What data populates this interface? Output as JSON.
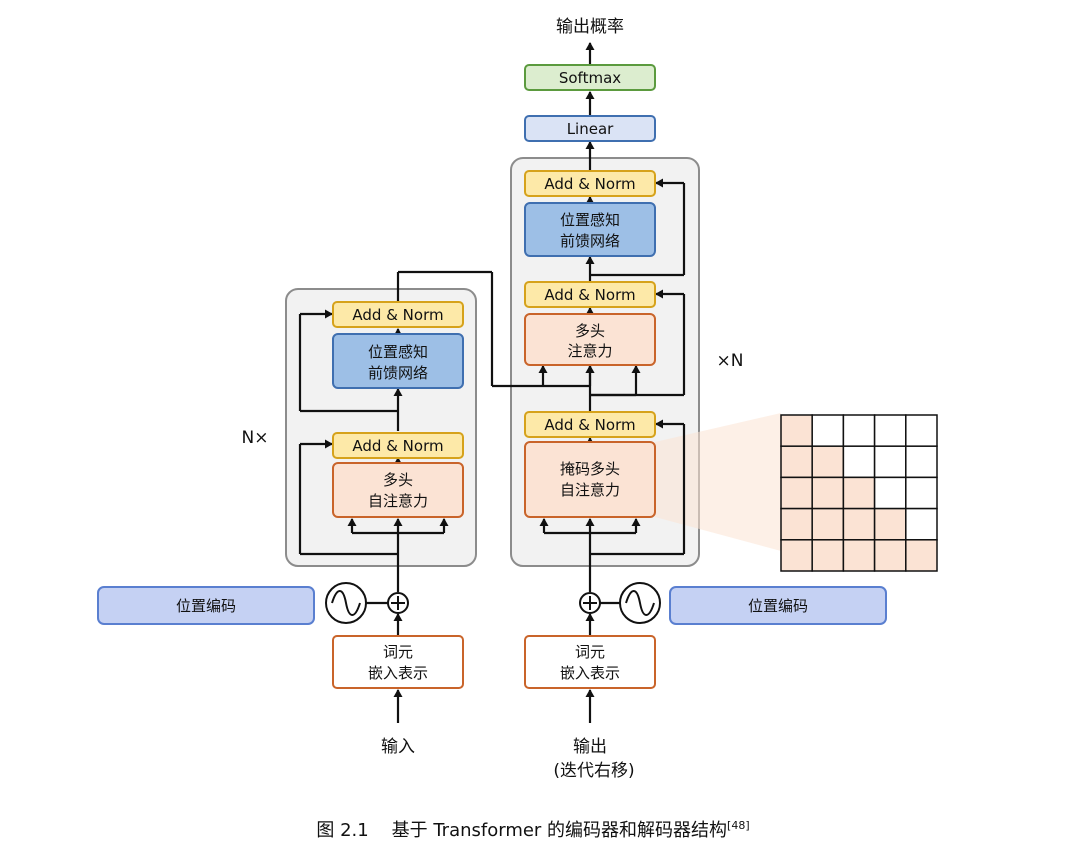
{
  "encoder": {
    "repeat_label": "N×",
    "input_label": "输入",
    "embedding_label": [
      "词元",
      "嵌入表示"
    ],
    "positional_encoding_label": "位置编码",
    "self_attention_label": [
      "多头",
      "自注意力"
    ],
    "ffn_label": [
      "位置感知",
      "前馈网络"
    ],
    "add_norm_label": "Add & Norm"
  },
  "decoder": {
    "repeat_label": "×N",
    "input_label": [
      "输出",
      "(迭代右移)"
    ],
    "embedding_label": [
      "词元",
      "嵌入表示"
    ],
    "positional_encoding_label": "位置编码",
    "masked_attention_label": [
      "掩码多头",
      "自注意力"
    ],
    "cross_attention_label": [
      "多头",
      "注意力"
    ],
    "ffn_label": [
      "位置感知",
      "前馈网络"
    ],
    "add_norm_label": "Add & Norm",
    "linear_label": "Linear",
    "softmax_label": "Softmax",
    "output_label": "输出概率"
  },
  "mask_matrix": {
    "size": 5
  },
  "caption": {
    "figure_number": "图 2.1",
    "text": "基于 Transformer 的编码器和解码器结构",
    "reference": "[48]"
  },
  "colors": {
    "add_norm_fill": "#fde9a8",
    "add_norm_stroke": "#d6a21b",
    "attention_fill": "#fbe3d4",
    "attention_stroke": "#c9642a",
    "ffn_fill": "#9dbfe6",
    "ffn_stroke": "#3f6fb0",
    "linear_fill": "#dae3f5",
    "linear_stroke": "#3f6fb0",
    "softmax_fill": "#dcedcf",
    "softmax_stroke": "#5b9a3e",
    "positional_fill": "#c5d1f3",
    "positional_stroke": "#5a7fd0",
    "block_fill": "#f2f2f2",
    "block_stroke": "#8c8c8c",
    "mask_fill": "#fbe3d4"
  }
}
